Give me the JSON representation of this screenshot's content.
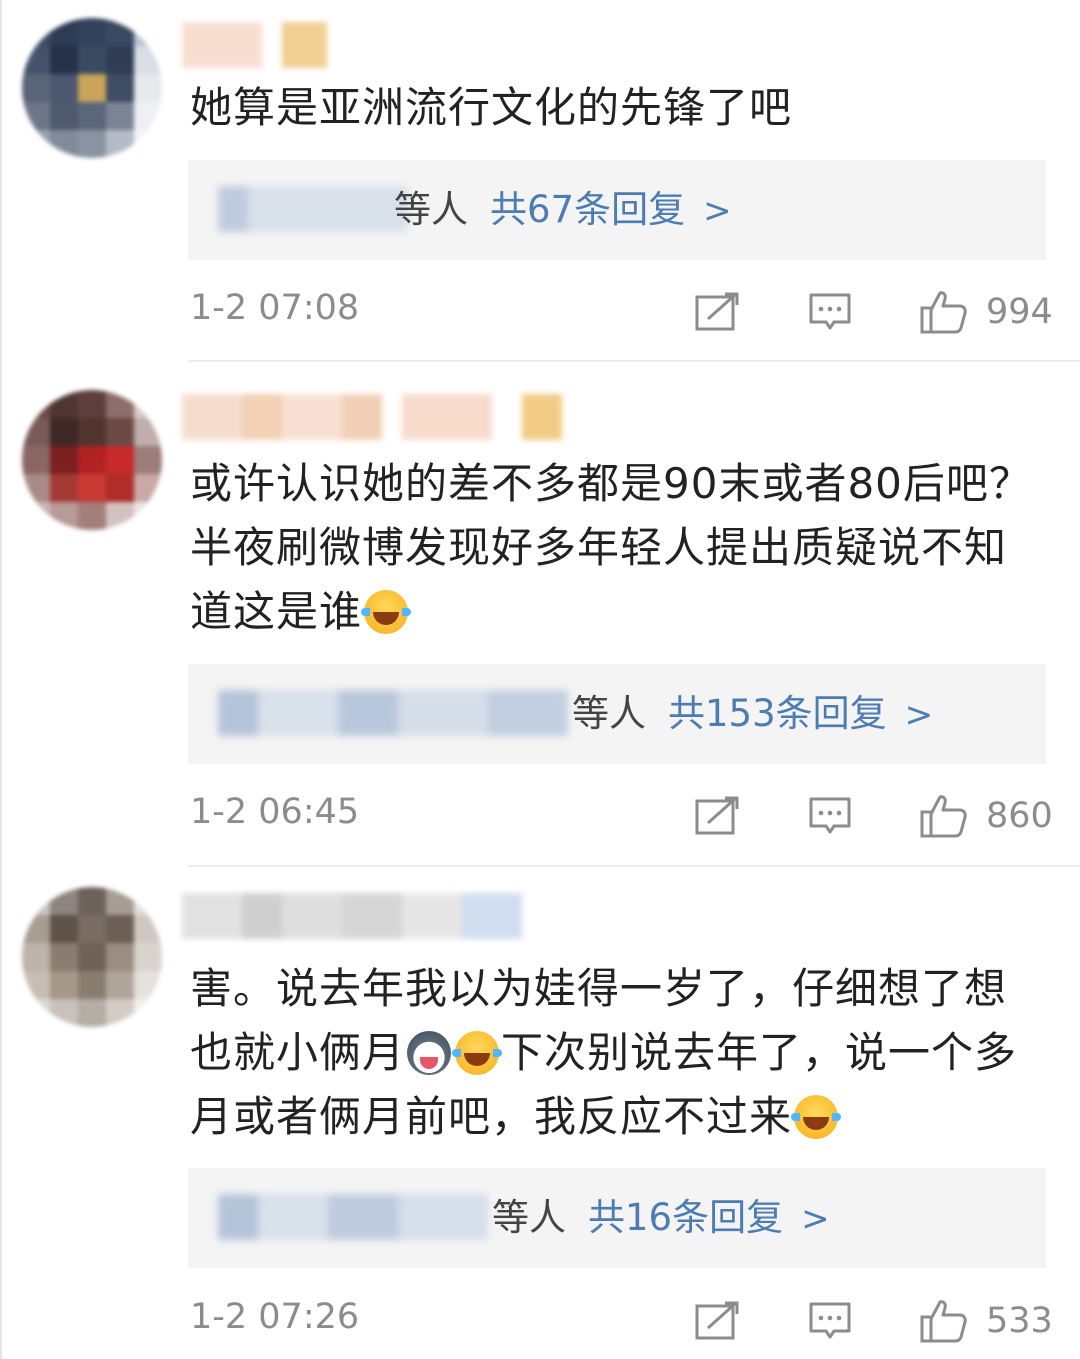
{
  "comments": [
    {
      "text": "她算是亚洲流行文化的先锋了吧",
      "reply_prefix": "等人",
      "reply_total": "共67条回复",
      "reply_chevron": ">",
      "time": "1-2 07:08",
      "likes": "994"
    },
    {
      "text": "或许认识她的差不多都是90末或者80后吧？半夜刷微博发现好多年轻人提出质疑说不知道这是谁",
      "reply_prefix": "等人",
      "reply_total": "共153条回复",
      "reply_chevron": ">",
      "time": "1-2 06:45",
      "likes": "860"
    },
    {
      "text_part1": "害。说去年我以为娃得一岁了，仔细想了想也就小俩月",
      "text_part2": "下次别说去年了，说一个多月或者俩月前吧，我反应不过来",
      "reply_prefix": "等人",
      "reply_total": "共16条回复",
      "reply_chevron": ">",
      "time": "1-2 07:26",
      "likes": "533"
    }
  ],
  "icons": {
    "share": "edit-share-icon",
    "comment": "comment-bubble-icon",
    "like": "thumbs-up-icon",
    "emoji_laugh": "tears-of-joy-emoji",
    "emoji_husky": "husky-face-emoji"
  },
  "colors": {
    "link": "#4d7cb3",
    "meta": "#8c8c8c",
    "reply_bg": "#f4f4f4",
    "text": "#222222"
  }
}
